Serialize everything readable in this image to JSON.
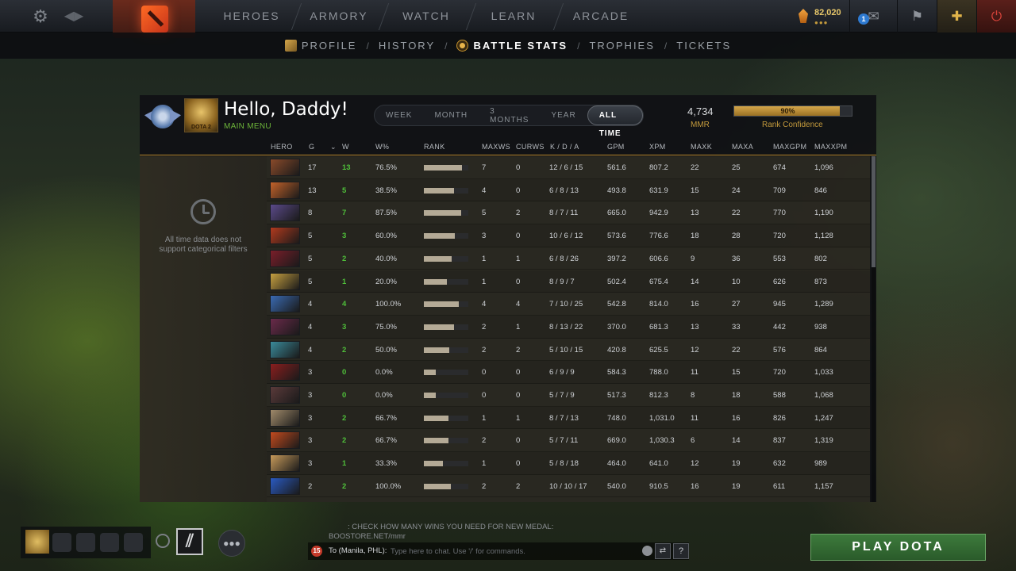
{
  "topbar": {
    "nav": [
      "HEROES",
      "ARMORY",
      "WATCH",
      "LEARN",
      "ARCADE"
    ],
    "currency": {
      "amount": "82,020",
      "dots": "●●●"
    },
    "mail_count": "1"
  },
  "subnav": {
    "items": [
      "PROFILE",
      "HISTORY",
      "BATTLE STATS",
      "TROPHIES",
      "TICKETS"
    ],
    "separator": "/",
    "active": "BATTLE STATS"
  },
  "profile": {
    "greeting": "Hello, Daddy!",
    "main_menu": "MAIN MENU",
    "avatar_caption": "DOTA 2"
  },
  "time_filter": {
    "options": [
      "WEEK",
      "MONTH",
      "3 MONTHS",
      "YEAR",
      "ALL TIME"
    ],
    "selected": "ALL TIME"
  },
  "mmr": {
    "value": "4,734",
    "label": "MMR"
  },
  "rank_confidence": {
    "value_text": "90%",
    "fraction": 0.9,
    "label": "Rank Confidence"
  },
  "side_message": "All time data does not support categorical filters",
  "table": {
    "headers": [
      "HERO",
      "G",
      "W",
      "W%",
      "RANK",
      "MAXWS",
      "CURWS",
      "K / D / A",
      "GPM",
      "XPM",
      "MAXK",
      "MAXA",
      "MAXGPM",
      "MAXXPM"
    ],
    "rows": [
      {
        "g": "17",
        "w": "13",
        "wp": "76.5%",
        "rank": 0.85,
        "maxws": "7",
        "curws": "0",
        "kda": "12 / 6 / 15",
        "gpm": "561.6",
        "xpm": "807.2",
        "maxk": "22",
        "maxa": "25",
        "maxgpm": "674",
        "maxxpm": "1,096"
      },
      {
        "g": "13",
        "w": "5",
        "wp": "38.5%",
        "rank": 0.68,
        "maxws": "4",
        "curws": "0",
        "kda": "6 / 8 / 13",
        "gpm": "493.8",
        "xpm": "631.9",
        "maxk": "15",
        "maxa": "24",
        "maxgpm": "709",
        "maxxpm": "846"
      },
      {
        "g": "8",
        "w": "7",
        "wp": "87.5%",
        "rank": 0.84,
        "maxws": "5",
        "curws": "2",
        "kda": "8 / 7 / 11",
        "gpm": "665.0",
        "xpm": "942.9",
        "maxk": "13",
        "maxa": "22",
        "maxgpm": "770",
        "maxxpm": "1,190"
      },
      {
        "g": "5",
        "w": "3",
        "wp": "60.0%",
        "rank": 0.7,
        "maxws": "3",
        "curws": "0",
        "kda": "10 / 6 / 12",
        "gpm": "573.6",
        "xpm": "776.6",
        "maxk": "18",
        "maxa": "28",
        "maxgpm": "720",
        "maxxpm": "1,128"
      },
      {
        "g": "5",
        "w": "2",
        "wp": "40.0%",
        "rank": 0.62,
        "maxws": "1",
        "curws": "1",
        "kda": "6 / 8 / 26",
        "gpm": "397.2",
        "xpm": "606.6",
        "maxk": "9",
        "maxa": "36",
        "maxgpm": "553",
        "maxxpm": "802"
      },
      {
        "g": "5",
        "w": "1",
        "wp": "20.0%",
        "rank": 0.52,
        "maxws": "1",
        "curws": "0",
        "kda": "8 / 9 / 7",
        "gpm": "502.4",
        "xpm": "675.4",
        "maxk": "14",
        "maxa": "10",
        "maxgpm": "626",
        "maxxpm": "873"
      },
      {
        "g": "4",
        "w": "4",
        "wp": "100.0%",
        "rank": 0.78,
        "maxws": "4",
        "curws": "4",
        "kda": "7 / 10 / 25",
        "gpm": "542.8",
        "xpm": "814.0",
        "maxk": "16",
        "maxa": "27",
        "maxgpm": "945",
        "maxxpm": "1,289"
      },
      {
        "g": "4",
        "w": "3",
        "wp": "75.0%",
        "rank": 0.68,
        "maxws": "2",
        "curws": "1",
        "kda": "8 / 13 / 22",
        "gpm": "370.0",
        "xpm": "681.3",
        "maxk": "13",
        "maxa": "33",
        "maxgpm": "442",
        "maxxpm": "938"
      },
      {
        "g": "4",
        "w": "2",
        "wp": "50.0%",
        "rank": 0.58,
        "maxws": "2",
        "curws": "2",
        "kda": "5 / 10 / 15",
        "gpm": "420.8",
        "xpm": "625.5",
        "maxk": "12",
        "maxa": "22",
        "maxgpm": "576",
        "maxxpm": "864"
      },
      {
        "g": "3",
        "w": "0",
        "wp": "0.0%",
        "rank": 0.26,
        "maxws": "0",
        "curws": "0",
        "kda": "6 / 9 / 9",
        "gpm": "584.3",
        "xpm": "788.0",
        "maxk": "11",
        "maxa": "15",
        "maxgpm": "720",
        "maxxpm": "1,033"
      },
      {
        "g": "3",
        "w": "0",
        "wp": "0.0%",
        "rank": 0.26,
        "maxws": "0",
        "curws": "0",
        "kda": "5 / 7 / 9",
        "gpm": "517.3",
        "xpm": "812.3",
        "maxk": "8",
        "maxa": "18",
        "maxgpm": "588",
        "maxxpm": "1,068"
      },
      {
        "g": "3",
        "w": "2",
        "wp": "66.7%",
        "rank": 0.55,
        "maxws": "1",
        "curws": "1",
        "kda": "8 / 7 / 13",
        "gpm": "748.0",
        "xpm": "1,031.0",
        "maxk": "11",
        "maxa": "16",
        "maxgpm": "826",
        "maxxpm": "1,247"
      },
      {
        "g": "3",
        "w": "2",
        "wp": "66.7%",
        "rank": 0.55,
        "maxws": "2",
        "curws": "0",
        "kda": "5 / 7 / 11",
        "gpm": "669.0",
        "xpm": "1,030.3",
        "maxk": "6",
        "maxa": "14",
        "maxgpm": "837",
        "maxxpm": "1,319"
      },
      {
        "g": "3",
        "w": "1",
        "wp": "33.3%",
        "rank": 0.42,
        "maxws": "1",
        "curws": "0",
        "kda": "5 / 8 / 18",
        "gpm": "464.0",
        "xpm": "641.0",
        "maxk": "12",
        "maxa": "19",
        "maxgpm": "632",
        "maxxpm": "989"
      },
      {
        "g": "2",
        "w": "2",
        "wp": "100.0%",
        "rank": 0.6,
        "maxws": "2",
        "curws": "2",
        "kda": "10 / 10 / 17",
        "gpm": "540.0",
        "xpm": "910.5",
        "maxk": "16",
        "maxa": "19",
        "maxgpm": "611",
        "maxxpm": "1,157"
      }
    ]
  },
  "hero_colors": [
    "#8a4a2a",
    "#c2622a",
    "#5b4a8a",
    "#b23a1e",
    "#7a1e2a",
    "#c6a040",
    "#3a6ab2",
    "#6a2a4a",
    "#3a8a9a",
    "#8a1e1e",
    "#5a3a3a",
    "#a08a6a",
    "#c24a1e",
    "#c69a5a",
    "#2a5ac2"
  ],
  "chat": {
    "line1": ": CHECK HOW MANY WINS YOU NEED FOR NEW MEDAL:",
    "line2": "BOOSTORE.NET/mmr",
    "unread": "15",
    "to": "To (Manila, PHL):",
    "placeholder": "Type here to chat. Use '/' for commands."
  },
  "play_button": "PLAY DOTA",
  "icons": [
    "gear-icon",
    "back-arrow-icon",
    "dota-logo-icon",
    "shard-icon",
    "mail-icon",
    "armory-icon",
    "plus-icon",
    "power-icon",
    "history-icon",
    "headset-icon",
    "friends-icon",
    "emoji-icon",
    "chat-icon",
    "help-icon"
  ]
}
